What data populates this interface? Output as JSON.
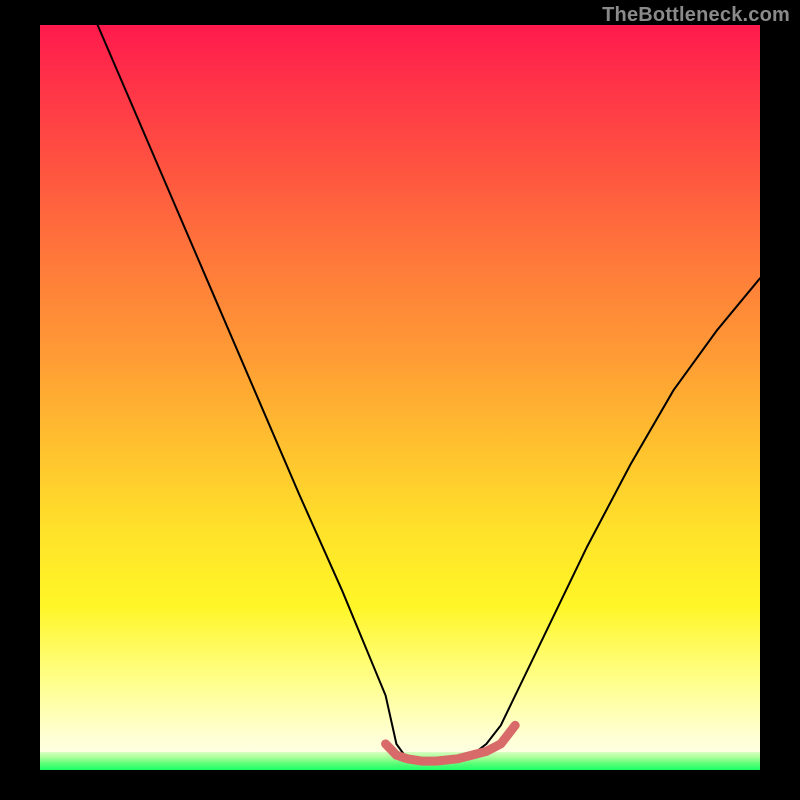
{
  "watermark": "TheBottleneck.com",
  "chart_data": {
    "type": "line",
    "title": "",
    "xlabel": "",
    "ylabel": "",
    "xlim": [
      0,
      100
    ],
    "ylim": [
      0,
      100
    ],
    "grid": false,
    "legend": false,
    "annotations": [],
    "series": [
      {
        "name": "main-curve",
        "color": "#000000",
        "x": [
          8,
          12,
          18,
          24,
          30,
          36,
          42,
          48,
          49.5,
          51,
          53,
          55,
          58,
          60,
          62,
          64,
          66,
          70,
          76,
          82,
          88,
          94,
          100
        ],
        "values": [
          100,
          91,
          77.5,
          64,
          50.5,
          37,
          24,
          10,
          3.5,
          1.5,
          1.2,
          1.2,
          1.5,
          2,
          3.5,
          6,
          10,
          18,
          30,
          41,
          51,
          59,
          66
        ]
      },
      {
        "name": "bottom-highlight",
        "color": "#d86a6a",
        "x": [
          48,
          49.5,
          51,
          53,
          55,
          58,
          60,
          62,
          64,
          66
        ],
        "values": [
          3.5,
          2.0,
          1.5,
          1.2,
          1.2,
          1.5,
          2.0,
          2.5,
          3.5,
          6
        ]
      }
    ],
    "background_gradient": {
      "top": "#ff1a4d",
      "mid1": "#ff9a35",
      "mid2": "#ffe22a",
      "bottom": "#fefff0",
      "green_band": "#1aff66"
    }
  }
}
